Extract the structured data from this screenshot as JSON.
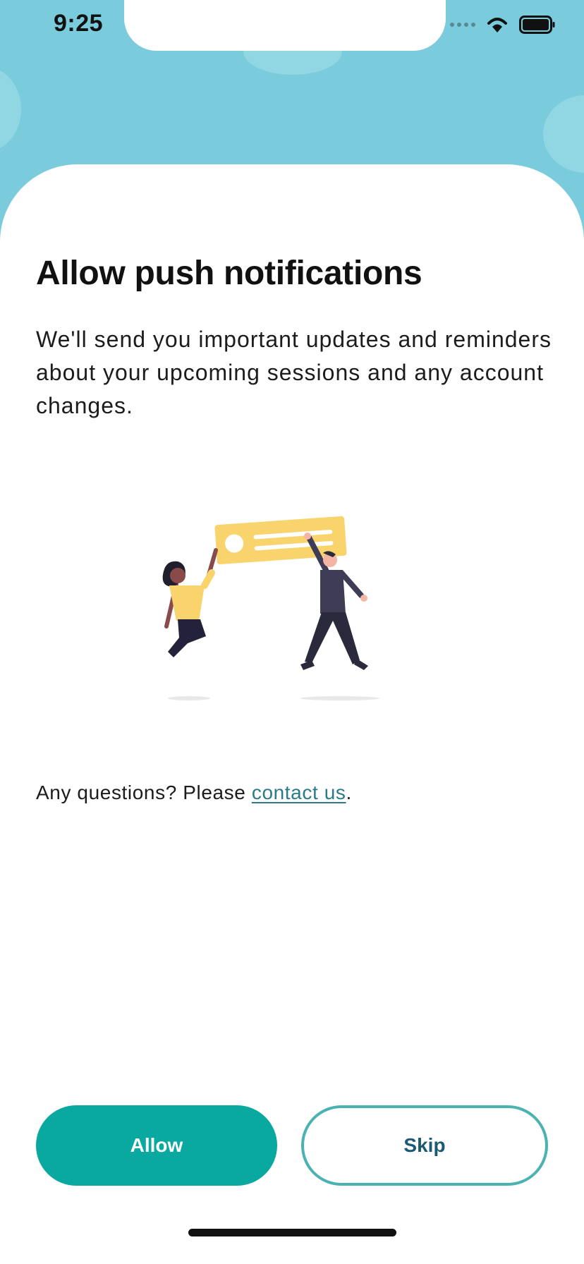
{
  "status_bar": {
    "time": "9:25"
  },
  "permission": {
    "title": "Allow push notifications",
    "description": "We'll send you important updates and reminders about your upcoming sessions and any account changes."
  },
  "contact": {
    "prefix": "Any questions? Please ",
    "link_label": "contact us",
    "suffix": "."
  },
  "buttons": {
    "allow_label": "Allow",
    "skip_label": "Skip"
  },
  "colors": {
    "header_background": "#7acbdc",
    "primary_button": "#0aa99f",
    "secondary_border": "#4ab3b1",
    "link": "#2c7a86",
    "illustration_card": "#f9d36b"
  },
  "icons": [
    "signal-icon",
    "wifi-icon",
    "battery-icon"
  ]
}
